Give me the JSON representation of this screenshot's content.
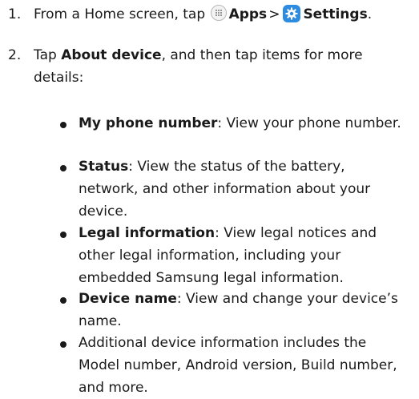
{
  "steps": [
    {
      "number": "1.",
      "prefix": "From a Home screen, tap ",
      "apps_label": "Apps",
      "separator": ">",
      "settings_label": "Settings",
      "suffix": "."
    },
    {
      "number": "2.",
      "prefix": "Tap ",
      "about_label": "About device",
      "suffix": ", and then tap items for more details:"
    }
  ],
  "bullets": [
    {
      "term": "My phone number",
      "text": ": View your phone number."
    },
    {
      "term": "Status",
      "text": ": View the status of the battery, network, and other information about your device."
    },
    {
      "term": "Legal information",
      "text": ": View legal notices and other legal information, including your embedded Samsung legal information."
    },
    {
      "term": "Device name",
      "text": ": View and change your device’s name."
    },
    {
      "term": "",
      "text": "Additional device information includes the Model number, Android version, Build number, and more."
    }
  ],
  "icons": {
    "apps": "apps-grid-icon",
    "settings": "settings-gear-icon",
    "settings_color": "#2d8ce0"
  }
}
